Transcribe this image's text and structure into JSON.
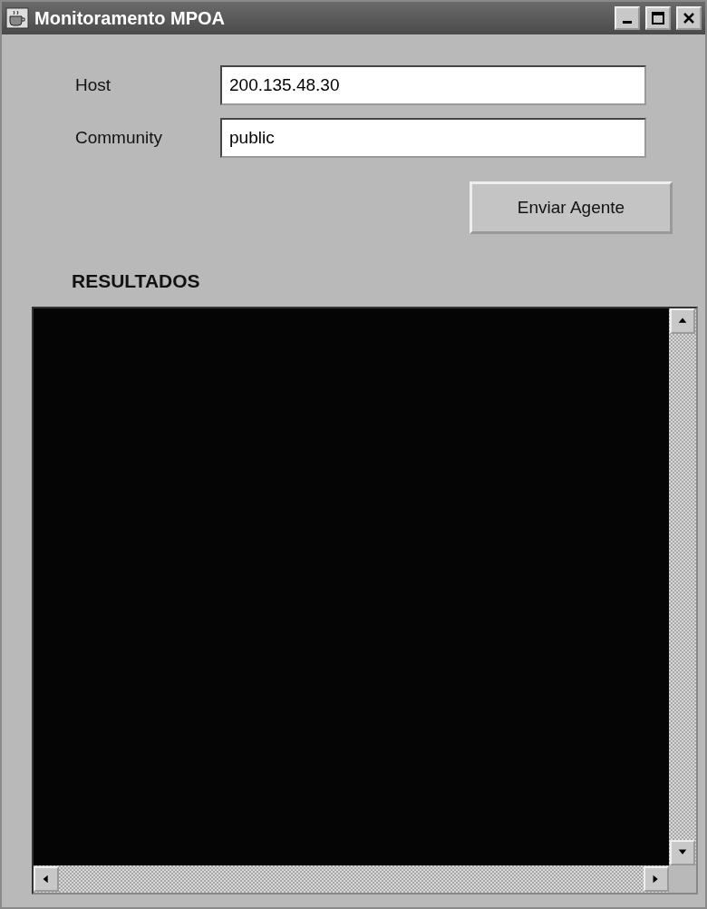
{
  "window": {
    "title": "Monitoramento MPOA"
  },
  "fields": [
    {
      "label": "Host",
      "value": "200.135.48.30"
    },
    {
      "label": "Community",
      "value": "public"
    }
  ],
  "button": {
    "label": "Enviar Agente"
  },
  "results": {
    "title": "RESULTADOS"
  }
}
